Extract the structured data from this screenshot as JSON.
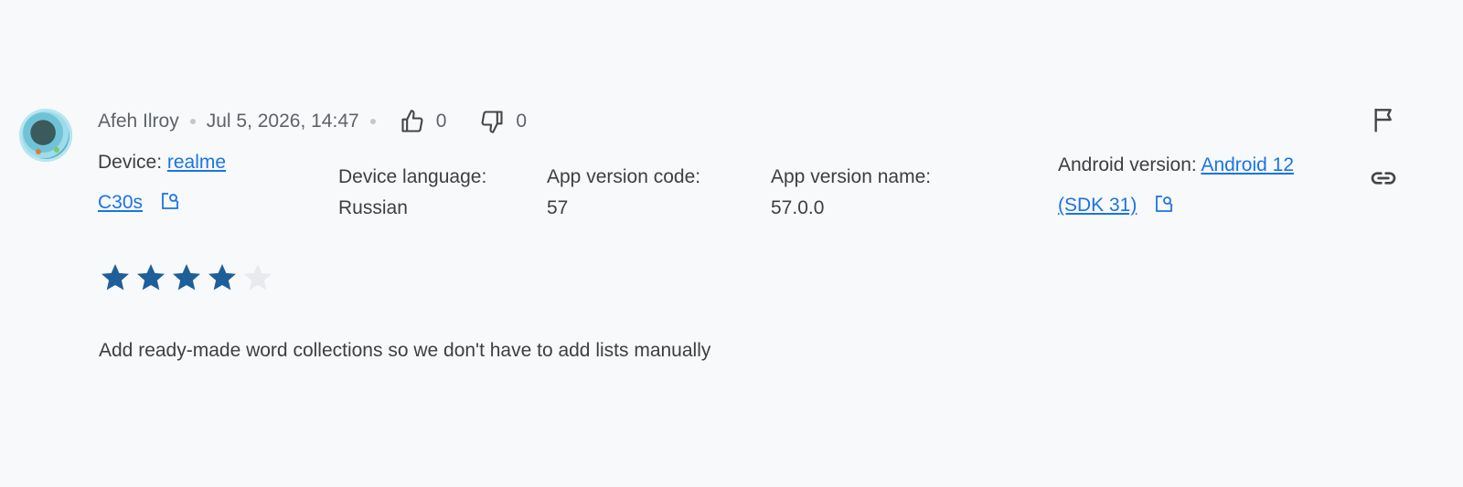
{
  "review": {
    "author": "Afeh Ilroy",
    "datetime": "Jul 5, 2026, 14:47",
    "thumbs_up_count": "0",
    "thumbs_down_count": "0",
    "device_label": "Device:",
    "device_value_line1": "realme",
    "device_value_line2": "C30s",
    "device_language_label": "Device language:",
    "device_language_value": "Russian",
    "app_version_code_label": "App version code:",
    "app_version_code_value": "57",
    "app_version_name_label": "App version name:",
    "app_version_name_value": "57.0.0",
    "android_version_label": "Android version:",
    "android_version_value_line1": "Android 12",
    "android_version_value_line2": "(SDK 31)",
    "rating": 4,
    "rating_max": 5,
    "text": "Add ready-made word collections so we don't have to add lists manually"
  },
  "colors": {
    "star_filled": "#1f5f99",
    "star_empty": "#e8eaed",
    "link": "#1a73e8",
    "icon": "#444746"
  },
  "icons": {
    "avatar": "avatar",
    "thumbs_up": "thumbs-up-icon",
    "thumbs_down": "thumbs-down-icon",
    "external_link": "open-in-new-icon",
    "flag": "flag-icon",
    "link": "link-icon",
    "star": "star-icon"
  }
}
